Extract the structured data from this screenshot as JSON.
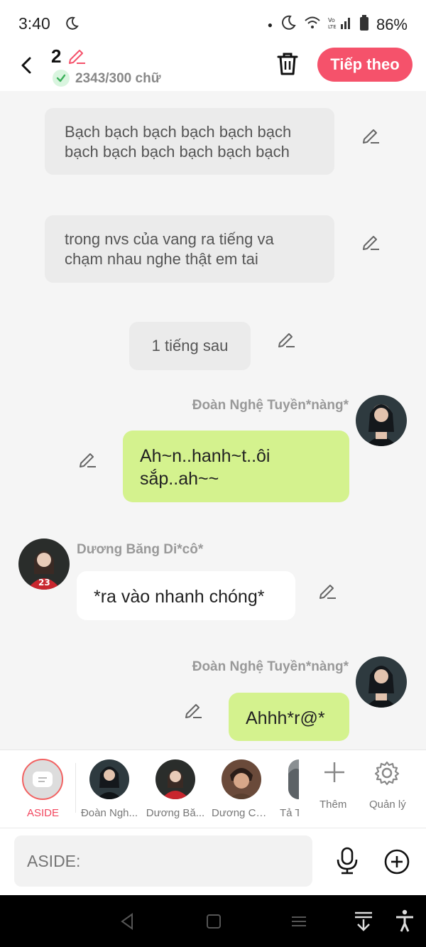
{
  "status_bar": {
    "time": "3:40",
    "battery": "86%"
  },
  "header": {
    "chapter_number": "2",
    "word_count": "2343/300 chữ",
    "next_label": "Tiếp theo"
  },
  "messages": {
    "narration_1": "Bạch bạch bạch bạch bạch bạch bạch bạch bạch bạch bạch bạch",
    "narration_2": "trong nvs của vang ra tiếng va chạm nhau nghe thật em tai",
    "narration_3": "1 tiếng sau",
    "msg_1_speaker": "Đoàn Nghệ Tuyền*nàng*",
    "msg_1_text": "Ah~n..hanh~t..ôi sắp..ah~~",
    "msg_2_speaker": "Dương Băng Di*cô*",
    "msg_2_text": "*ra vào nhanh chóng*",
    "msg_3_speaker": "Đoàn Nghệ Tuyền*nàng*",
    "msg_3_text": "Ahhh*r@*"
  },
  "character_bar": {
    "aside_label": "ASIDE",
    "characters": [
      {
        "name": "Đoàn Ngh..."
      },
      {
        "name": "Dương Bă..."
      },
      {
        "name": "Dương Chí..."
      },
      {
        "name": "Tả T"
      }
    ],
    "add_label": "Thêm",
    "manage_label": "Quản lý"
  },
  "input": {
    "placeholder": "ASIDE:"
  },
  "colors": {
    "accent": "#f5526b",
    "bubble_self": "#d4f28e",
    "narration_bg": "#ebebeb"
  }
}
